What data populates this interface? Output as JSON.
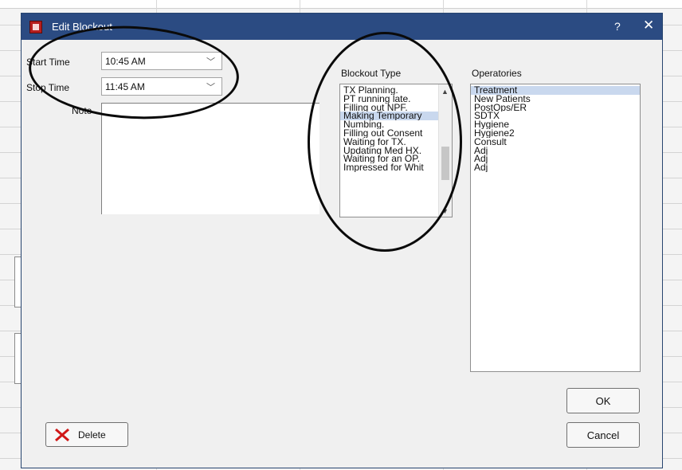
{
  "window": {
    "title": "Edit Blockout",
    "help_label": "?",
    "close_label": "✕"
  },
  "start_time": {
    "label": "Start Time",
    "value": "10:45 AM"
  },
  "stop_time": {
    "label": "Stop Time",
    "value": "11:45 AM"
  },
  "note": {
    "label": "Note"
  },
  "blockout_type": {
    "label": "Blockout Type",
    "items": [
      "TX Planning.",
      "PT running late.",
      "Filling out NPF.",
      "Making Temporary",
      "Numbing.",
      "Filling out Consent",
      "Waiting for TX.",
      "Updating Med HX.",
      "Waiting for an OP.",
      "Impressed for Whit"
    ],
    "selected": "Making Temporary"
  },
  "operatories": {
    "label": "Operatories",
    "items": [
      "Treatment",
      "New Patients",
      "PostOps/ER",
      "SDTX",
      "Hygiene",
      "Hygiene2",
      "Consult",
      "Adj",
      "Adj",
      "Adj"
    ],
    "selected": "Treatment"
  },
  "buttons": {
    "ok": "OK",
    "cancel": "Cancel",
    "delete": "Delete"
  },
  "icons": {
    "app": "calendar-icon",
    "delete": "red-x-icon",
    "dropdown": "chevron-down-icon"
  },
  "colors": {
    "titlebar": "#2b4b82",
    "selection": "#c9d8ee",
    "delete_icon": "#d01818"
  }
}
